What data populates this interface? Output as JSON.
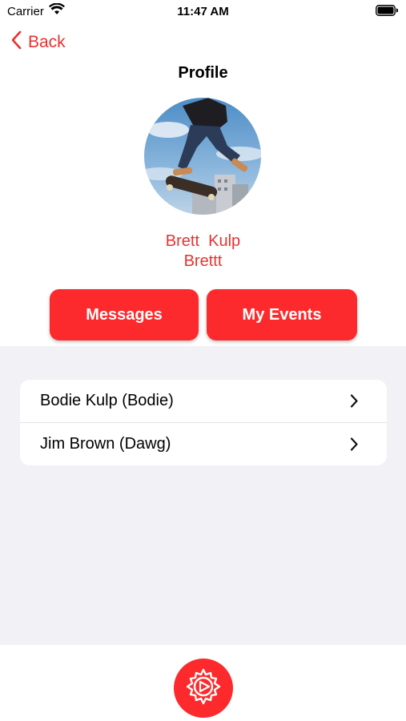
{
  "status_bar": {
    "carrier": "Carrier",
    "time": "11:47 AM",
    "wifi_icon": "wifi-icon",
    "battery_icon": "battery-icon"
  },
  "nav": {
    "back_label": "Back",
    "title": "Profile",
    "back_icon": "chevron-left-icon"
  },
  "profile": {
    "full_name": "Brett  Kulp",
    "username": "Brettt",
    "avatar_icon": "avatar-photo"
  },
  "actions": {
    "messages": "Messages",
    "my_events": "My Events"
  },
  "list": [
    {
      "label": "Bodie Kulp (Bodie)",
      "icon": "chevron-right-icon"
    },
    {
      "label": "Jim Brown (Dawg)",
      "icon": "chevron-right-icon"
    }
  ],
  "bottom": {
    "settings_icon": "settings-gear-icon"
  },
  "colors": {
    "accent": "#fc2a2c",
    "accent_text": "#e8322f",
    "grouped_bg": "#f1f1f6"
  }
}
